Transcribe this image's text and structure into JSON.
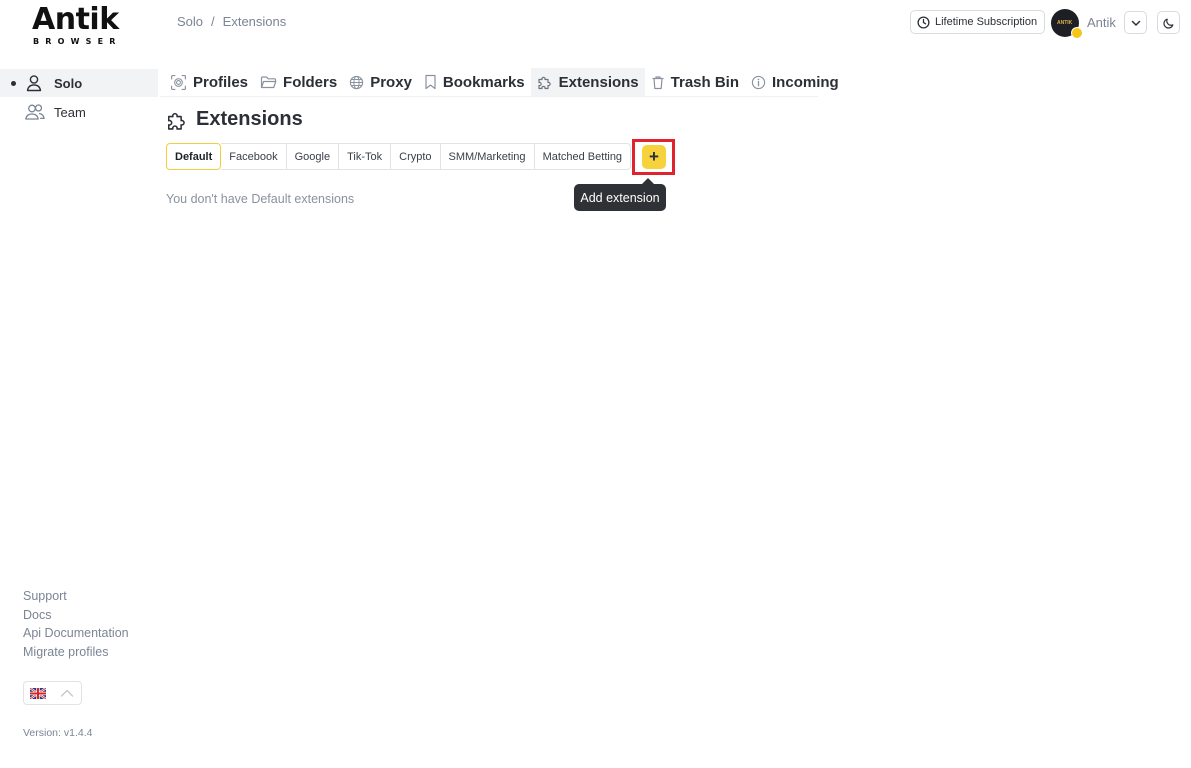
{
  "logo": {
    "word": "Antik",
    "sub": "BROWSER"
  },
  "breadcrumb": {
    "first": "Solo",
    "separator": "/",
    "current": "Extensions"
  },
  "header": {
    "subscription_label": "Lifetime Subscription",
    "user_name": "Antik",
    "avatar_mark": "ANTIK"
  },
  "sidebar": {
    "items": [
      {
        "label": "Solo",
        "icon": "user-icon",
        "active": true
      },
      {
        "label": "Team",
        "icon": "users-icon",
        "active": false
      }
    ],
    "footer_links": [
      "Support",
      "Docs",
      "Api Documentation",
      "Migrate profiles"
    ],
    "language_flag": "uk-flag-icon",
    "version": "Version: v1.4.4"
  },
  "nav": {
    "tabs": [
      {
        "label": "Profiles",
        "icon": "fingerprint-icon"
      },
      {
        "label": "Folders",
        "icon": "folder-icon"
      },
      {
        "label": "Proxy",
        "icon": "globe-icon"
      },
      {
        "label": "Bookmarks",
        "icon": "bookmark-icon"
      },
      {
        "label": "Extensions",
        "icon": "puzzle-icon",
        "active": true
      },
      {
        "label": "Trash Bin",
        "icon": "trash-icon"
      },
      {
        "label": "Incoming",
        "icon": "info-icon"
      }
    ]
  },
  "page": {
    "title": "Extensions",
    "categories": [
      "Default",
      "Facebook",
      "Google",
      "Tik-Tok",
      "Crypto",
      "SMM/Marketing",
      "Matched Betting"
    ],
    "active_category": "Default",
    "add_symbol": "+",
    "tooltip": "Add extension",
    "empty_message": "You don't have Default extensions"
  },
  "colors": {
    "accent": "#f6d33c",
    "highlight": "#e0232d",
    "muted": "#7c8595"
  }
}
